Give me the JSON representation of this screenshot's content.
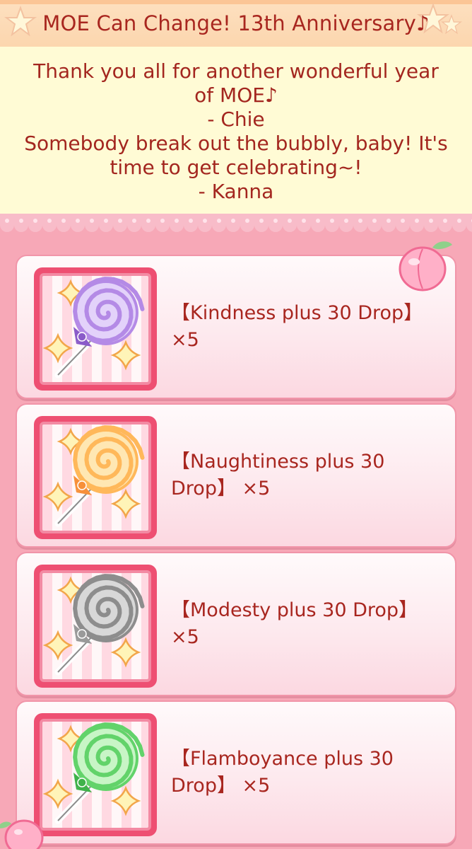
{
  "header": {
    "title": "MOE Can Change! 13th Anniversary♪"
  },
  "message": {
    "lines": [
      "Thank you all for another wonderful year",
      "of MOE♪",
      "- Chie",
      "Somebody break out the bubbly, baby! It's",
      "time to get celebrating~!",
      "- Kanna"
    ]
  },
  "rewards": [
    {
      "line1": "【Kindness plus 30 Drop】",
      "line2": "×5",
      "candy_color": "#b48ae6",
      "candy_light": "#e3d2fa",
      "ribbon_color": "#8a5bc9"
    },
    {
      "line1": "【Naughtiness plus 30",
      "line2": "Drop】 ×5",
      "candy_color": "#ffb85a",
      "candy_light": "#ffe7b3",
      "ribbon_color": "#f7903a"
    },
    {
      "line1": "【Modesty plus 30 Drop】",
      "line2": "×5",
      "candy_color": "#8d8d8d",
      "candy_light": "#d8d8d8",
      "ribbon_color": "#9a9a9a"
    },
    {
      "line1": "【Flamboyance plus 30",
      "line2": "Drop】 ×5",
      "candy_color": "#62d36a",
      "candy_light": "#c8f5c6",
      "ribbon_color": "#3fb24a"
    }
  ],
  "icons": {
    "candy": "lollipop-icon",
    "sparkle": "sparkle-icon",
    "peach": "peach-icon",
    "star": "star-icon"
  },
  "colors": {
    "text": "#a8261f",
    "frame": "#ee4f72",
    "background": "#f7a8b7"
  }
}
